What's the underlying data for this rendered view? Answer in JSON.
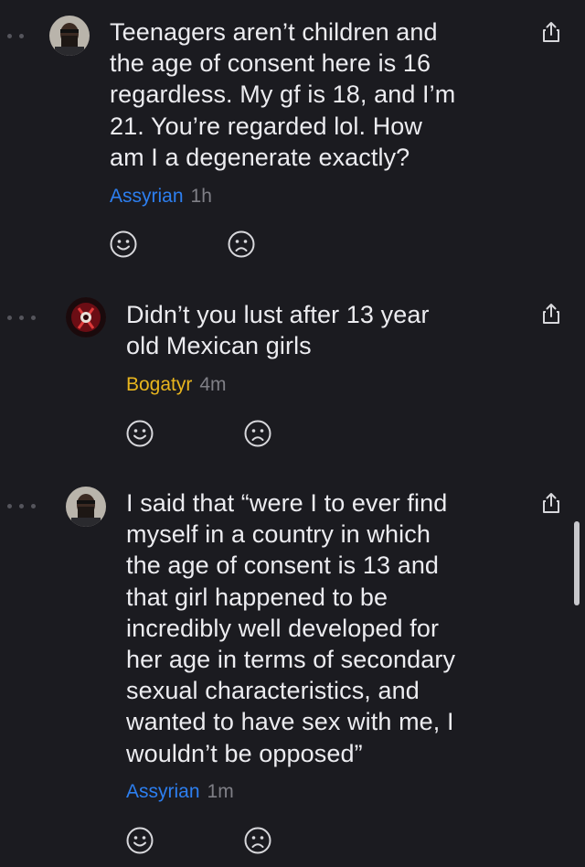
{
  "comments": [
    {
      "lines": [
        "Teenagers aren’t children and",
        "the age of consent here is 16",
        "regardless. My gf is 18, and I’m",
        "21. You’re regarded lol. How",
        "am I a degenerate exactly?"
      ],
      "author": "Assyrian",
      "author_color": "#2d7ff0",
      "time": "1h"
    },
    {
      "lines": [
        "Didn’t you lust after 13 year",
        "old Mexican girls"
      ],
      "author": "Bogatyr",
      "author_color": "#e8b51e",
      "time": "4m"
    },
    {
      "lines": [
        "I said that “were I to ever find",
        "myself in a country in which",
        "the age of consent is 13 and",
        "that girl happened to be",
        "incredibly well developed for",
        "her age in terms of secondary",
        "sexual characteristics, and",
        "wanted to have sex with me, I",
        "wouldn’t be opposed”"
      ],
      "author": "Assyrian",
      "author_color": "#2d7ff0",
      "time": "1m"
    }
  ],
  "icons": {
    "reply_dots": "more-dots-icon",
    "upvote": "smiley-face-icon",
    "downvote": "frown-face-icon",
    "share": "share-icon"
  }
}
